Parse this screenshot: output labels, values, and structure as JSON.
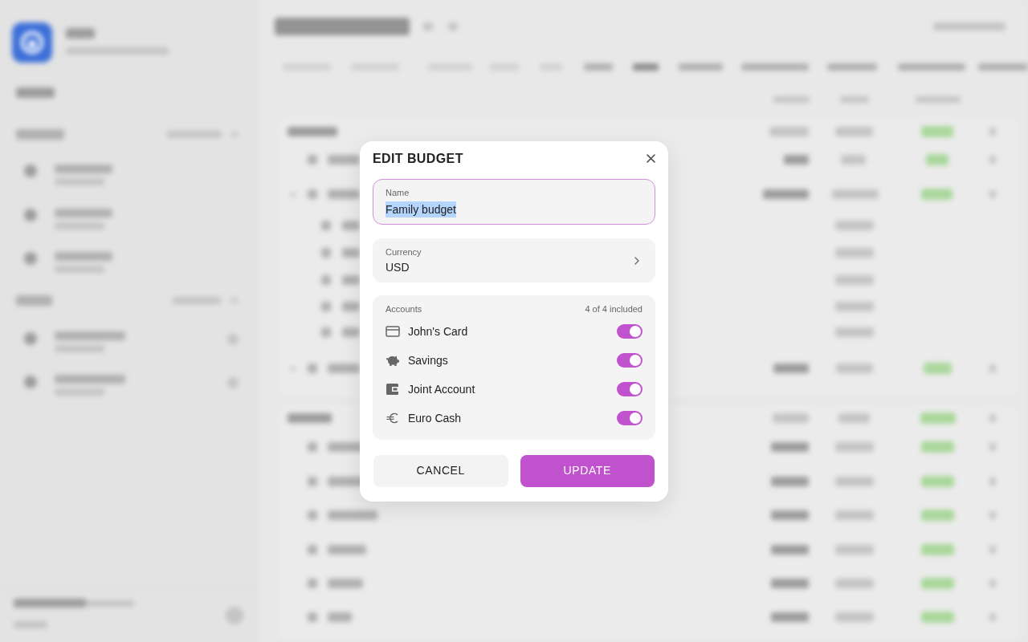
{
  "dialog": {
    "title": "EDIT BUDGET",
    "fields": [
      {
        "kind": "text",
        "label": "Name",
        "value": "Family budget",
        "focused": true,
        "text_selected": true
      },
      {
        "kind": "picker",
        "label": "Currency",
        "value": "USD",
        "focused": false,
        "text_selected": false
      }
    ],
    "accounts": {
      "label": "Accounts",
      "summary": "4 of 4 included",
      "items": [
        {
          "name": "John's Card",
          "on": true
        },
        {
          "name": "Savings",
          "on": true
        },
        {
          "name": "Joint Account",
          "on": true
        },
        {
          "name": "Euro Cash",
          "on": true
        }
      ]
    },
    "buttons": [
      {
        "label": "CANCEL",
        "kind": "secondary"
      },
      {
        "label": "UPDATE",
        "kind": "primary"
      }
    ]
  }
}
